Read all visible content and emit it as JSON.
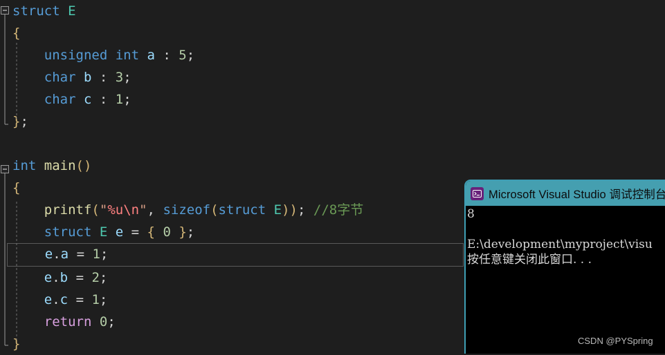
{
  "editor": {
    "background_color": "#1e1e1e",
    "lines": [
      {
        "indent": 0,
        "fold": "collapse-minus",
        "tokens": [
          {
            "t": "struct",
            "c": "kw"
          },
          {
            "t": " ",
            "c": "punct"
          },
          {
            "t": "E",
            "c": "type"
          }
        ]
      },
      {
        "indent": 0,
        "fold": "guide-bar",
        "tokens": [
          {
            "t": "{",
            "c": "brace"
          }
        ]
      },
      {
        "indent": 0,
        "fold": "guide-dash",
        "tokens": [
          {
            "t": "    ",
            "c": "punct"
          },
          {
            "t": "unsigned",
            "c": "kw"
          },
          {
            "t": " ",
            "c": "punct"
          },
          {
            "t": "int",
            "c": "kw"
          },
          {
            "t": " ",
            "c": "punct"
          },
          {
            "t": "a",
            "c": "var"
          },
          {
            "t": " : ",
            "c": "punct"
          },
          {
            "t": "5",
            "c": "num"
          },
          {
            "t": ";",
            "c": "punct"
          }
        ]
      },
      {
        "indent": 0,
        "fold": "guide-dash",
        "tokens": [
          {
            "t": "    ",
            "c": "punct"
          },
          {
            "t": "char",
            "c": "kw"
          },
          {
            "t": " ",
            "c": "punct"
          },
          {
            "t": "b",
            "c": "var"
          },
          {
            "t": " : ",
            "c": "punct"
          },
          {
            "t": "3",
            "c": "num"
          },
          {
            "t": ";",
            "c": "punct"
          }
        ]
      },
      {
        "indent": 0,
        "fold": "guide-dash",
        "tokens": [
          {
            "t": "    ",
            "c": "punct"
          },
          {
            "t": "char",
            "c": "kw"
          },
          {
            "t": " ",
            "c": "punct"
          },
          {
            "t": "c",
            "c": "var"
          },
          {
            "t": " : ",
            "c": "punct"
          },
          {
            "t": "1",
            "c": "num"
          },
          {
            "t": ";",
            "c": "punct"
          }
        ]
      },
      {
        "indent": 0,
        "fold": "guide-bar-end",
        "tokens": [
          {
            "t": "}",
            "c": "brace"
          },
          {
            "t": ";",
            "c": "punct"
          }
        ]
      },
      {
        "indent": 0,
        "fold": "none",
        "tokens": []
      },
      {
        "indent": 0,
        "fold": "collapse-minus",
        "tokens": [
          {
            "t": "int",
            "c": "kw"
          },
          {
            "t": " ",
            "c": "punct"
          },
          {
            "t": "main",
            "c": "fn"
          },
          {
            "t": "()",
            "c": "brace"
          }
        ]
      },
      {
        "indent": 0,
        "fold": "guide-bar",
        "tokens": [
          {
            "t": "{",
            "c": "brace"
          }
        ]
      },
      {
        "indent": 0,
        "fold": "guide-dash",
        "tokens": [
          {
            "t": "    ",
            "c": "punct"
          },
          {
            "t": "printf",
            "c": "fn"
          },
          {
            "t": "(",
            "c": "brace"
          },
          {
            "t": "\"",
            "c": "str"
          },
          {
            "t": "%u",
            "c": "esc"
          },
          {
            "t": "\\n",
            "c": "esc"
          },
          {
            "t": "\"",
            "c": "str"
          },
          {
            "t": ", ",
            "c": "punct"
          },
          {
            "t": "sizeof",
            "c": "kw"
          },
          {
            "t": "(",
            "c": "brace"
          },
          {
            "t": "struct",
            "c": "kw"
          },
          {
            "t": " ",
            "c": "punct"
          },
          {
            "t": "E",
            "c": "type"
          },
          {
            "t": "))",
            "c": "brace"
          },
          {
            "t": ";",
            "c": "punct"
          },
          {
            "t": " ",
            "c": "punct"
          },
          {
            "t": "//8字节",
            "c": "cmt"
          }
        ]
      },
      {
        "indent": 0,
        "fold": "guide-dash",
        "tokens": [
          {
            "t": "    ",
            "c": "punct"
          },
          {
            "t": "struct",
            "c": "kw"
          },
          {
            "t": " ",
            "c": "punct"
          },
          {
            "t": "E",
            "c": "type"
          },
          {
            "t": " ",
            "c": "punct"
          },
          {
            "t": "e",
            "c": "var"
          },
          {
            "t": " = ",
            "c": "punct"
          },
          {
            "t": "{ ",
            "c": "brace"
          },
          {
            "t": "0",
            "c": "num"
          },
          {
            "t": " }",
            "c": "brace"
          },
          {
            "t": ";",
            "c": "punct"
          }
        ]
      },
      {
        "indent": 0,
        "fold": "guide-dash",
        "current": true,
        "tokens": [
          {
            "t": "    ",
            "c": "punct"
          },
          {
            "t": "e",
            "c": "var"
          },
          {
            "t": ".",
            "c": "punct"
          },
          {
            "t": "a",
            "c": "var"
          },
          {
            "t": " = ",
            "c": "punct"
          },
          {
            "t": "1",
            "c": "num"
          },
          {
            "t": ";",
            "c": "punct"
          }
        ]
      },
      {
        "indent": 0,
        "fold": "guide-dash",
        "tokens": [
          {
            "t": "    ",
            "c": "punct"
          },
          {
            "t": "e",
            "c": "var"
          },
          {
            "t": ".",
            "c": "punct"
          },
          {
            "t": "b",
            "c": "var"
          },
          {
            "t": " = ",
            "c": "punct"
          },
          {
            "t": "2",
            "c": "num"
          },
          {
            "t": ";",
            "c": "punct"
          }
        ]
      },
      {
        "indent": 0,
        "fold": "guide-dash",
        "tokens": [
          {
            "t": "    ",
            "c": "punct"
          },
          {
            "t": "e",
            "c": "var"
          },
          {
            "t": ".",
            "c": "punct"
          },
          {
            "t": "c",
            "c": "var"
          },
          {
            "t": " = ",
            "c": "punct"
          },
          {
            "t": "1",
            "c": "num"
          },
          {
            "t": ";",
            "c": "punct"
          }
        ]
      },
      {
        "indent": 0,
        "fold": "guide-dash",
        "tokens": [
          {
            "t": "    ",
            "c": "punct"
          },
          {
            "t": "return",
            "c": "ctrl"
          },
          {
            "t": " ",
            "c": "punct"
          },
          {
            "t": "0",
            "c": "num"
          },
          {
            "t": ";",
            "c": "punct"
          }
        ]
      },
      {
        "indent": 0,
        "fold": "guide-bar-end",
        "tokens": [
          {
            "t": "}",
            "c": "brace"
          }
        ]
      }
    ]
  },
  "console": {
    "title": "Microsoft Visual Studio 调试控制台",
    "icon": "console-app-icon",
    "titlebar_color": "#459fb0",
    "background_color": "#000000",
    "output": [
      "8",
      "",
      "E:\\development\\myproject\\visu",
      "按任意键关闭此窗口. . ."
    ]
  },
  "watermark": {
    "text": "CSDN @PYSpring"
  }
}
